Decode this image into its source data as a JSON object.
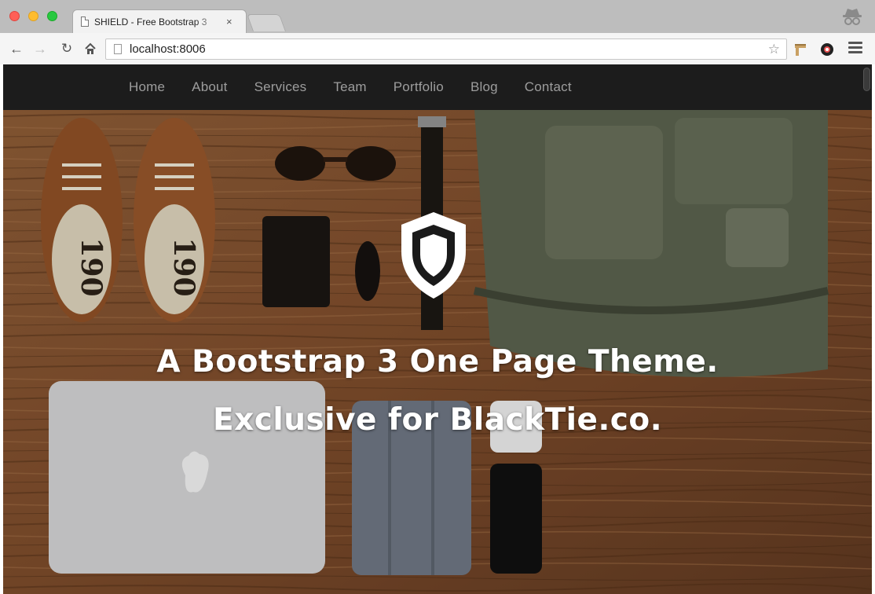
{
  "browser": {
    "tab_title": "SHIELD - Free Bootstrap 3",
    "tab_close": "×",
    "url": "localhost:8006",
    "colors": {
      "close": "#ff5f57",
      "minimize": "#febc2e",
      "maximize": "#28c840"
    }
  },
  "nav": {
    "items": [
      {
        "label": "Home"
      },
      {
        "label": "About"
      },
      {
        "label": "Services"
      },
      {
        "label": "Team"
      },
      {
        "label": "Portfolio"
      },
      {
        "label": "Blog"
      },
      {
        "label": "Contact"
      }
    ]
  },
  "hero": {
    "logo_icon": "shield-icon",
    "headline": "A Bootstrap 3 One Page Theme.",
    "subheadline": "Exclusive for BlackTie.co.",
    "shoe_label_left": "190",
    "shoe_label_right": "190"
  }
}
